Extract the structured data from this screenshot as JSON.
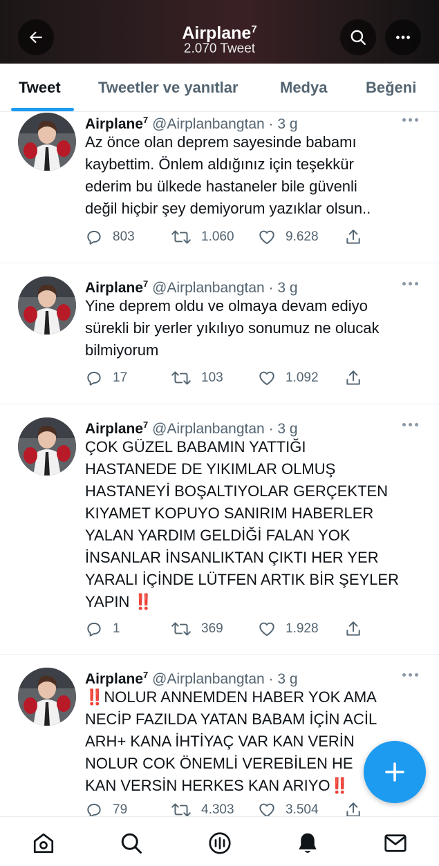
{
  "header": {
    "title": "Airplane",
    "title_sup": "7",
    "subtitle": "2.070 Tweet",
    "back_icon": "back-arrow-icon",
    "search_icon": "search-icon",
    "more_icon": "more-icon"
  },
  "tabs": [
    {
      "label": "Tweet",
      "active": true
    },
    {
      "label": "Tweetler ve yanıtlar",
      "active": false
    },
    {
      "label": "Medya",
      "active": false
    },
    {
      "label": "Beğeni",
      "active": false
    }
  ],
  "tweets": [
    {
      "name": "Airplane",
      "name_sup": "7",
      "handle_time": "@Airplanbangtan · 3 g",
      "text": "Az önce olan deprem sayesinde babamı\nkaybettim. Önlem aldığınız için teşekkür\nederim bu ülkede hastaneler bile güvenli\ndeğil hiçbir şey demiyorum yazıklar olsun..",
      "replies": "803",
      "retweets": "1.060",
      "likes": "9.628"
    },
    {
      "name": "Airplane",
      "name_sup": "7",
      "handle_time": "@Airplanbangtan · 3 g",
      "text": "Yine deprem oldu ve olmaya devam ediyo\nsürekli bir yerler yıkılıyo sonumuz ne olucak\nbilmiyorum",
      "replies": "17",
      "retweets": "103",
      "likes": "1.092"
    },
    {
      "name": "Airplane",
      "name_sup": "7",
      "handle_time": "@Airplanbangtan · 3 g",
      "text": "ÇOK GÜZEL BABAMIN YATTIĞI\nHASTANEDE DE YIKIMLAR OLMUŞ\nHASTANEYİ BOŞALTIYOLAR GERÇEKTEN\nKIYAMET KOPUYO SANIRIM HABERLER\nYALAN YARDIM GELDİĞİ FALAN YOK\nİNSANLAR İNSANLIKTAN ÇIKTI HER YER\nYARALI İÇİNDE LÜTFEN ARTIK BİR ŞEYLER\nYAPIN ‼️",
      "replies": "1",
      "retweets": "369",
      "likes": "1.928"
    },
    {
      "name": "Airplane",
      "name_sup": "7",
      "handle_time": "@Airplanbangtan · 3 g",
      "text": "‼️NOLUR ANNEMDEN HABER YOK AMA\nNECİP FAZILDA YATAN BABAM İÇİN ACİL\nARH+ KANA İHTİYAÇ VAR KAN VERİN\nNOLUR COK ÖNEMLİ VEREBİLEN HE\nKAN VERSİN HERKES KAN ARIYO‼️",
      "replies": "79",
      "retweets": "4.303",
      "likes": "3.504"
    }
  ],
  "action_icons": [
    "reply-icon",
    "retweet-icon",
    "like-icon",
    "share-icon"
  ],
  "fab": {
    "icon": "compose-plus-icon"
  },
  "bottom_nav": [
    "home-icon",
    "search-icon",
    "spaces-icon",
    "notifications-icon",
    "messages-icon"
  ],
  "colors": {
    "accent": "#1d9bf0",
    "text": "#0f1419",
    "muted": "#536471"
  }
}
